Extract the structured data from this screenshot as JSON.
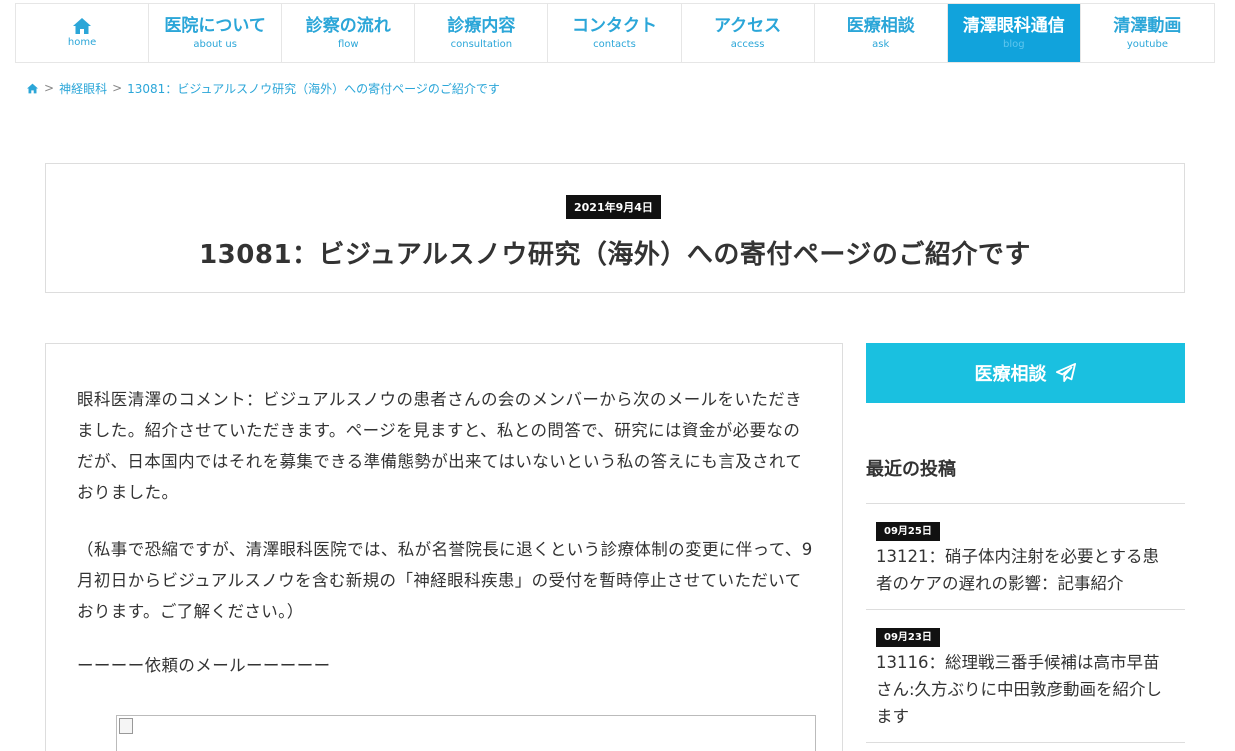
{
  "nav": {
    "items": [
      {
        "label": "",
        "sub": "home",
        "icon": "home-icon"
      },
      {
        "label": "医院について",
        "sub": "about us"
      },
      {
        "label": "診察の流れ",
        "sub": "flow"
      },
      {
        "label": "診療内容",
        "sub": "consultation"
      },
      {
        "label": "コンタクト",
        "sub": "contacts"
      },
      {
        "label": "アクセス",
        "sub": "access"
      },
      {
        "label": "医療相談",
        "sub": "ask"
      },
      {
        "label": "清澤眼科通信",
        "sub": "blog"
      },
      {
        "label": "清澤動画",
        "sub": "youtube"
      }
    ],
    "active_index": 7
  },
  "breadcrumb": {
    "sep": ">",
    "category": "神経眼科",
    "current": "13081：ビジュアルスノウ研究（海外）への寄付ページのご紹介です"
  },
  "post": {
    "date": "2021年9月4日",
    "title": "13081：ビジュアルスノウ研究（海外）への寄付ページのご紹介です",
    "paragraphs": [
      "眼科医清澤のコメント：ビジュアルスノウの患者さんの会のメンバーから次のメールをいただきました。紹介させていただきます。ページを見ますと、私との問答で、研究には資金が必要なのだが、日本国内ではそれを募集できる準備態勢が出来てはいないという私の答えにも言及されておりました。",
      "（私事で恐縮ですが、清澤眼科医院では、私が名誉院長に退くという診療体制の変更に伴って、9月初日からビジュアルスノウを含む新規の「神経眼科疾患」の受付を暫時停止させていただいております。ご了解ください。）",
      "ーーーー依頼のメールーーーーー"
    ]
  },
  "sidebar": {
    "consult_label": "医療相談",
    "recent_heading": "最近の投稿",
    "recent": [
      {
        "date": "09月25日",
        "title": "13121：硝子体内注射を必要とする患者のケアの遅れの影響：記事紹介"
      },
      {
        "date": "09月23日",
        "title": "13116：総理戦三番手候補は高市早苗さん:久方ぶりに中田敦彦動画を紹介します"
      }
    ]
  },
  "colors": {
    "accent": "#2ba6d8",
    "active_nav": "#11a3dc",
    "consult_button": "#1ac0e0",
    "badge": "#111111"
  }
}
